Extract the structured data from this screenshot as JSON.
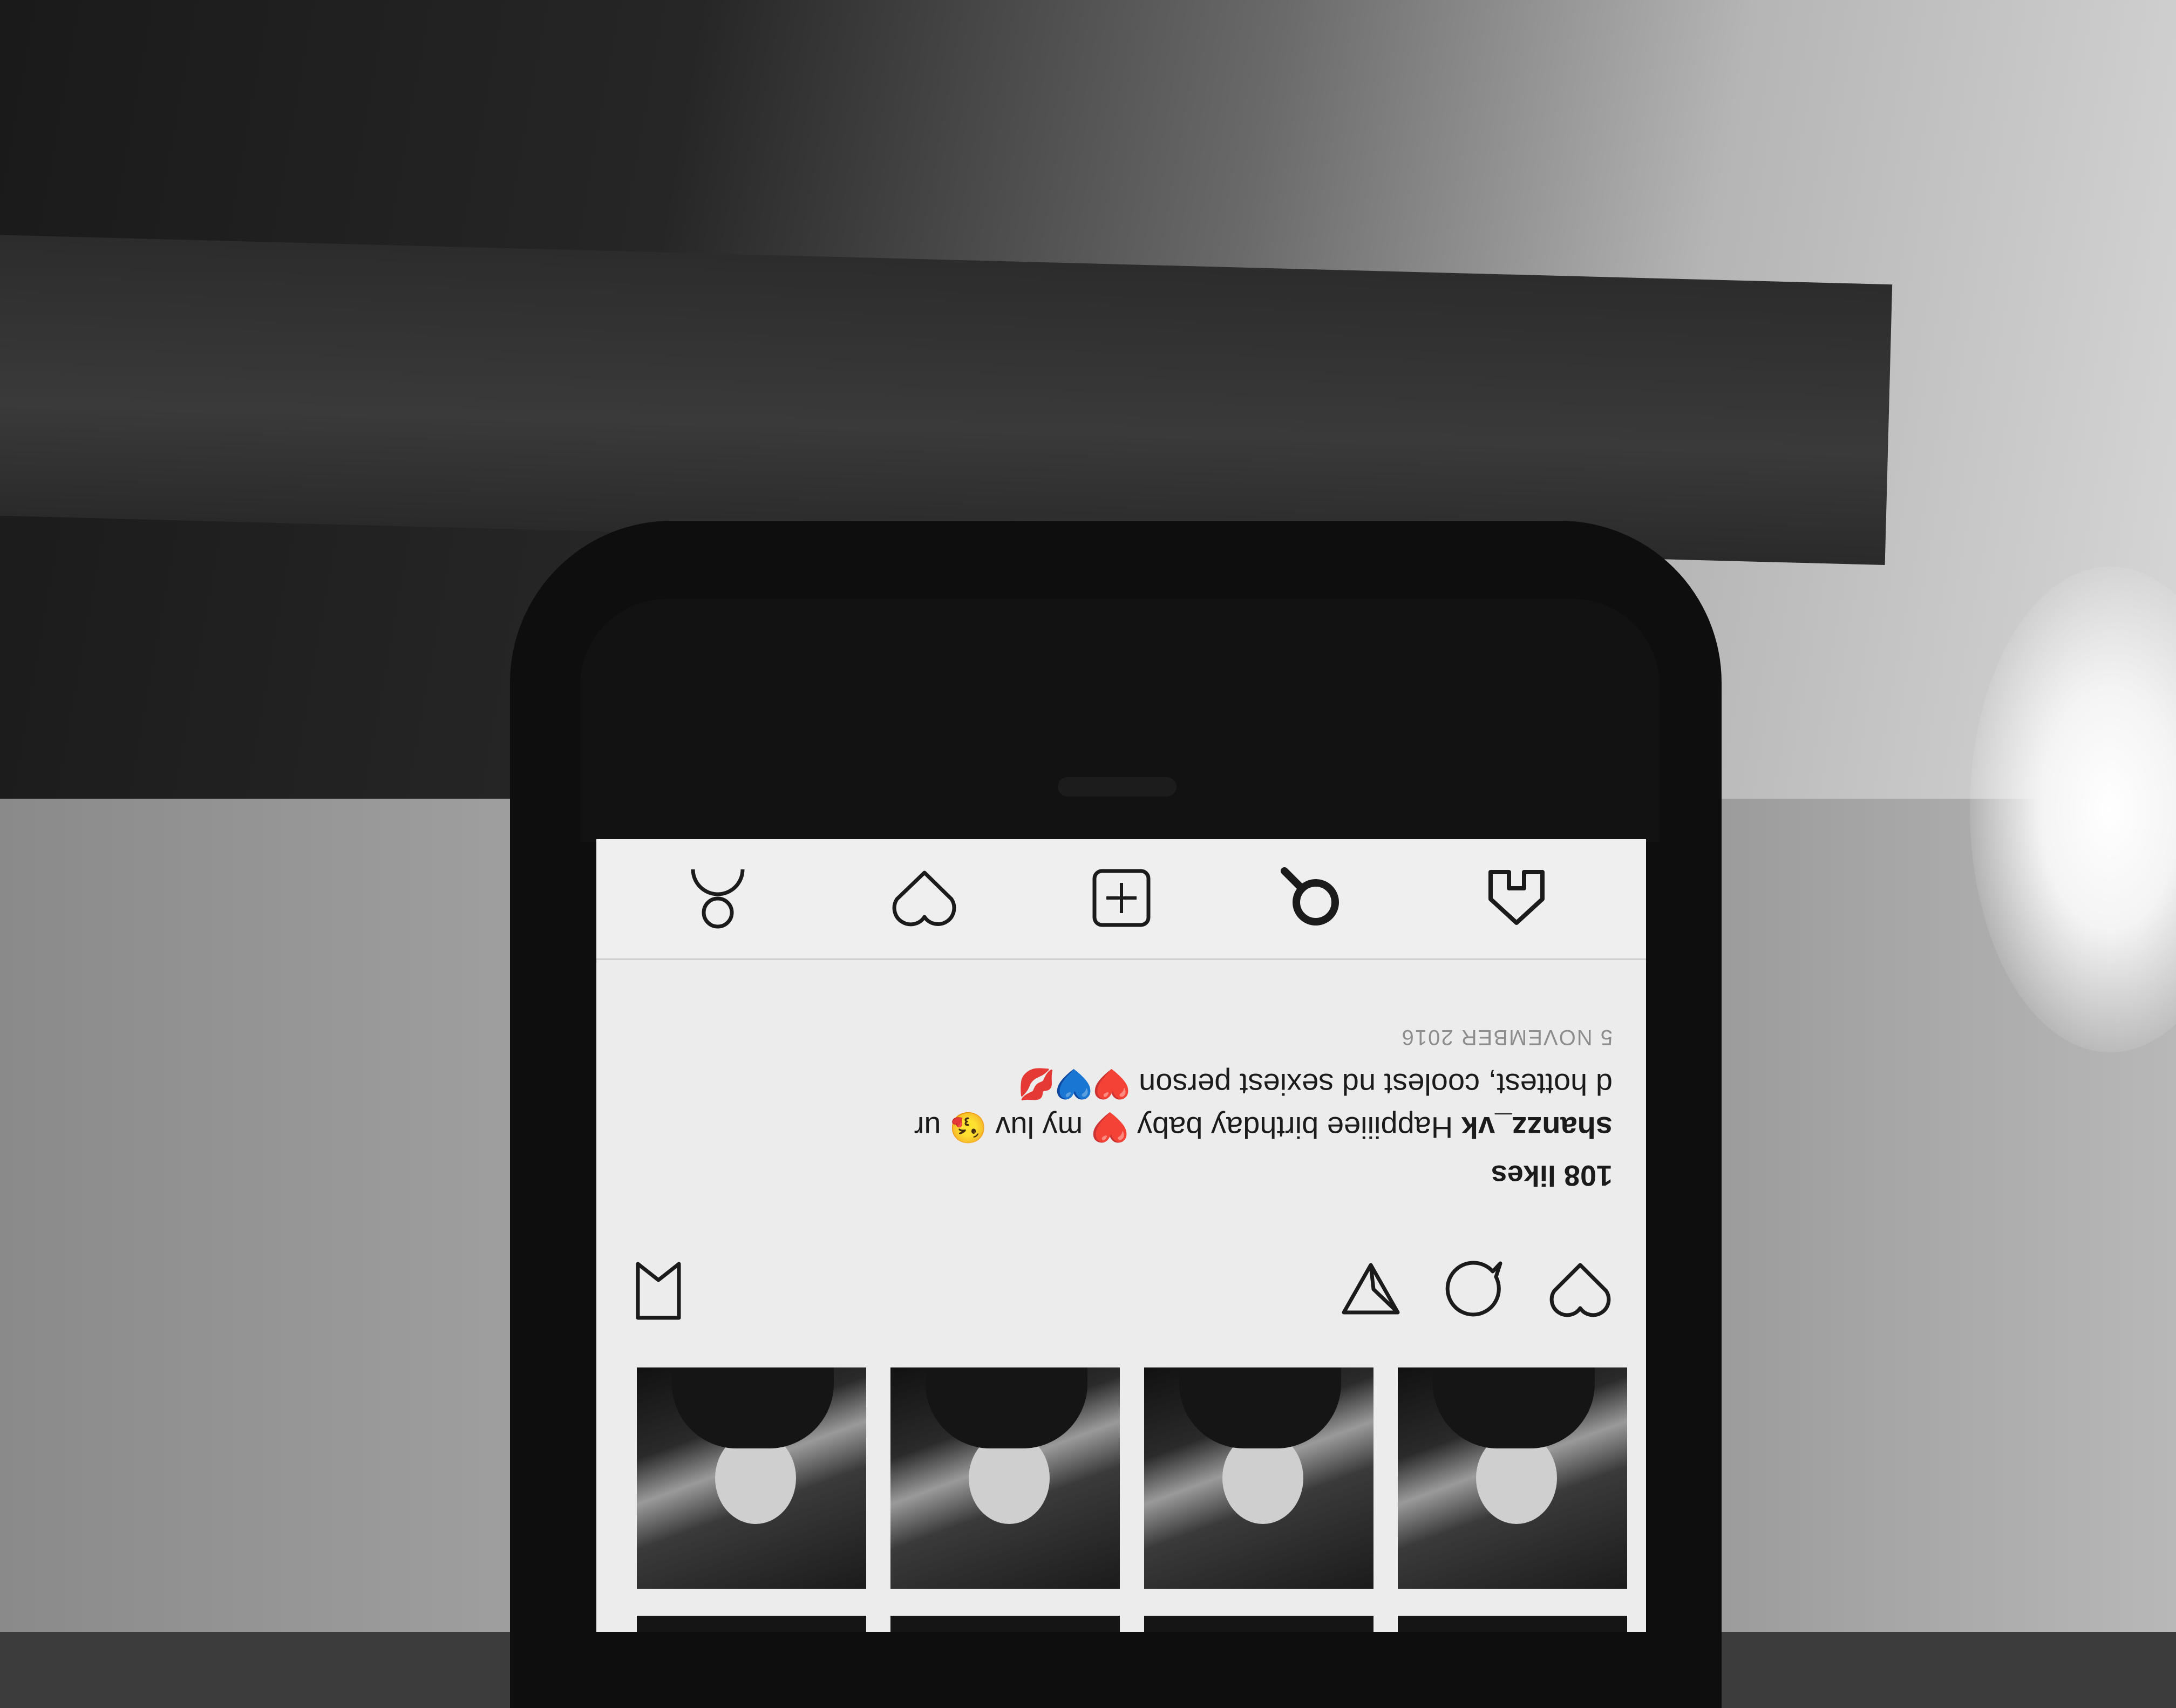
{
  "post": {
    "likes": "108 likes",
    "username": "shanzz_vk",
    "caption_line1": "Happiiiee birthday baby ❤️ my luv 😘 ur",
    "caption_line2": "d hottest, coolest nd sexiest person ❤️💙💋",
    "date": "5 NOVEMBER 2016"
  },
  "post_actions": {
    "icons": [
      "heart-icon",
      "comment-icon",
      "share-icon",
      "bookmark-icon"
    ]
  },
  "tab_bar": {
    "icons": [
      "home-icon",
      "search-icon",
      "add-post-icon",
      "activity-heart-icon",
      "profile-icon"
    ]
  },
  "colors": {
    "screen_bg": "#ececec",
    "text": "#1b1b1b",
    "muted_text": "#8d8d8d",
    "heart_red": "#d8232a",
    "heart_blue": "#2a62d8"
  }
}
